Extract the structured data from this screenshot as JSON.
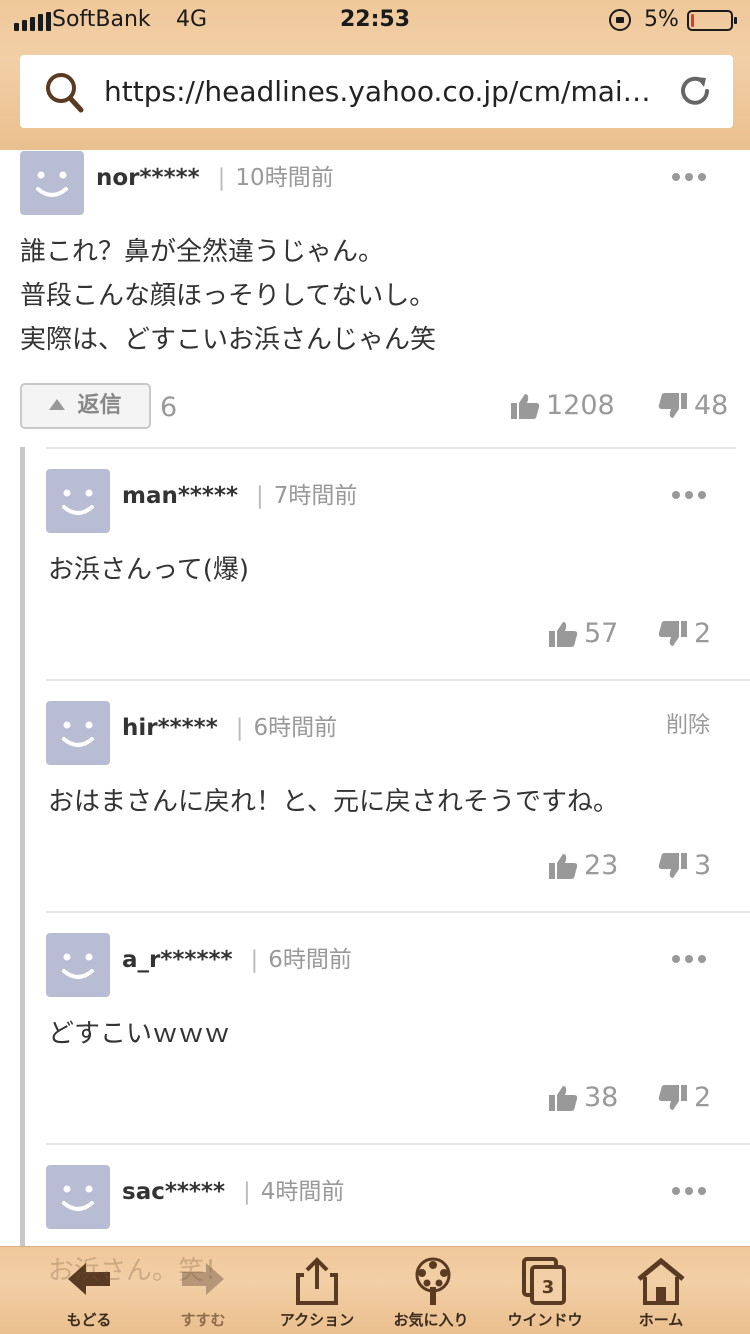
{
  "status_bar": {
    "carrier": "SoftBank",
    "network": "4G",
    "time": "22:53",
    "battery_percent": "5%",
    "battery_level": 0.05,
    "battery_color": "#e0392f"
  },
  "browser": {
    "url": "https://headlines.yahoo.co.jp/cm/main…",
    "search_icon": "search-icon",
    "reload_icon": "reload-icon"
  },
  "top_comment": {
    "user": "nor*****",
    "time": "10時間前",
    "lines": [
      "誰これ？鼻が全然違うじゃん。",
      "普段こんな顔ほっそりしてないし。",
      "実際は、どすこいお浜さんじゃん笑"
    ],
    "reply_label": "返信",
    "reply_count": "6",
    "likes": "1208",
    "dislikes": "48"
  },
  "replies": [
    {
      "user": "man*****",
      "time": "7時間前",
      "text": "お浜さんって(爆)",
      "likes": "57",
      "dislikes": "2",
      "action": "more"
    },
    {
      "user": "hir*****",
      "time": "6時間前",
      "text": "おはまさんに戻れ！と、元に戻されそうですね。",
      "likes": "23",
      "dislikes": "3",
      "action": "削除"
    },
    {
      "user": "a_r******",
      "time": "6時間前",
      "text": "どすこいｗｗｗ",
      "likes": "38",
      "dislikes": "2",
      "action": "more"
    },
    {
      "user": "sac*****",
      "time": "4時間前",
      "text": "お浜さん。笑！",
      "action": "more"
    }
  ],
  "toolbar": {
    "back": "もどる",
    "forward": "すすむ",
    "action": "アクション",
    "favorites": "お気に入り",
    "window": "ウインドウ",
    "window_count": "3",
    "home": "ホーム"
  },
  "colors": {
    "wood": "#efc897",
    "avatar": "#b9bdd4",
    "text_gray": "#999999"
  }
}
